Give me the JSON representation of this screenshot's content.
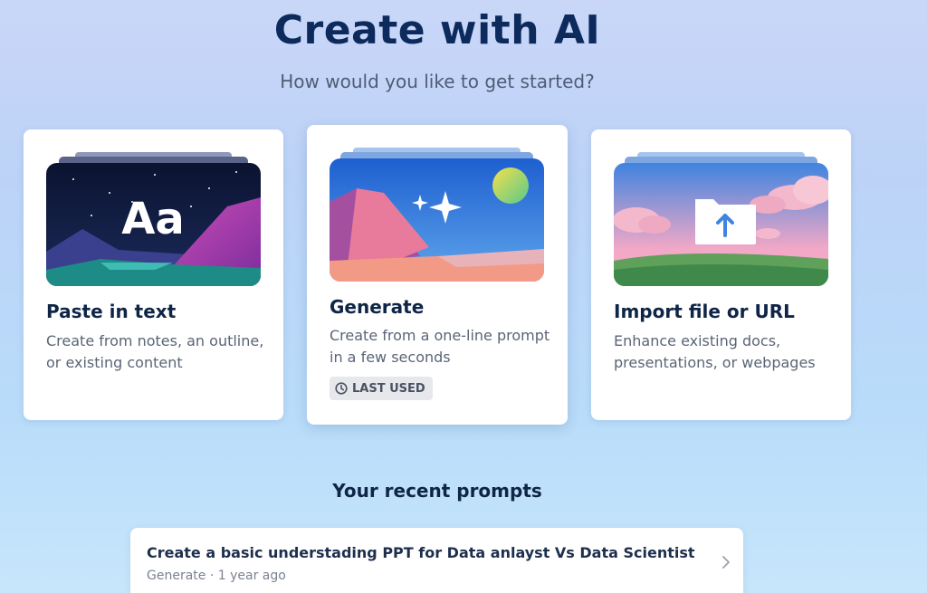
{
  "header": {
    "title": "Create with AI",
    "subtitle": "How would you like to get started?"
  },
  "options": [
    {
      "title": "Paste in text",
      "description": "Create from notes, an outline, or existing content",
      "illustration": "Aa"
    },
    {
      "title": "Generate",
      "description": "Create from a one-line prompt in a few seconds",
      "badge": "LAST USED",
      "badge_icon": "clock-icon",
      "illustration_icon": "sparkle-icon"
    },
    {
      "title": "Import file or URL",
      "description": "Enhance existing docs, presentations, or webpages",
      "illustration_icon": "folder-upload-icon"
    }
  ],
  "recent": {
    "heading": "Your recent prompts",
    "items": [
      {
        "title": "Create a basic understading PPT for Data anlayst Vs Data Scientist",
        "meta": "Generate · 1 year ago"
      }
    ]
  },
  "colors": {
    "title": "#0d2a5c",
    "card_bg": "#ffffff",
    "badge_bg": "#e6e8ec"
  }
}
